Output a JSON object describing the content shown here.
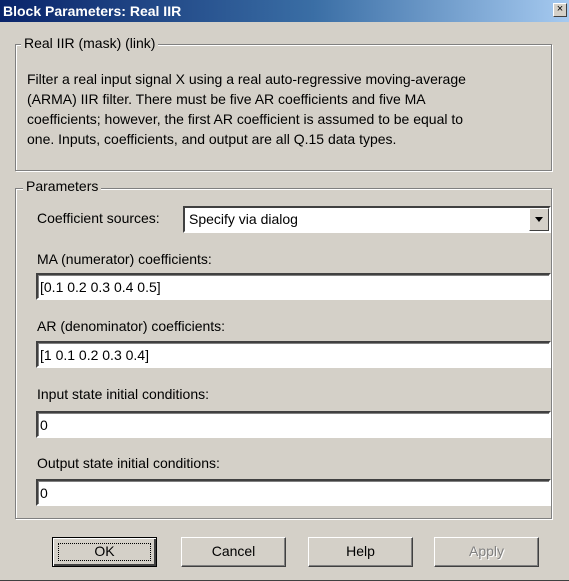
{
  "window": {
    "title": "Block Parameters: Real IIR",
    "close_glyph": "×"
  },
  "mask_group": {
    "legend": "Real IIR (mask) (link)",
    "description_lines": [
      "Filter a real input signal X using a real auto-regressive moving-average",
      "(ARMA) IIR filter. There must be five AR coefficients and five MA",
      "coefficients; however, the first AR coefficient is assumed to be equal to",
      "one. Inputs, coefficients, and output are all Q.15 data types."
    ]
  },
  "parameters": {
    "legend": "Parameters",
    "coefficient_sources": {
      "label": "Coefficient sources:",
      "value": "Specify via dialog"
    },
    "ma": {
      "label": "MA (numerator) coefficients:",
      "value": "[0.1 0.2 0.3 0.4 0.5]"
    },
    "ar": {
      "label": "AR (denominator) coefficients:",
      "value": "[1 0.1 0.2 0.3 0.4]"
    },
    "input_state": {
      "label": "Input state initial conditions:",
      "value": "0"
    },
    "output_state": {
      "label": "Output state initial conditions:",
      "value": "0"
    }
  },
  "buttons": {
    "ok": "OK",
    "cancel": "Cancel",
    "help": "Help",
    "apply": "Apply"
  }
}
